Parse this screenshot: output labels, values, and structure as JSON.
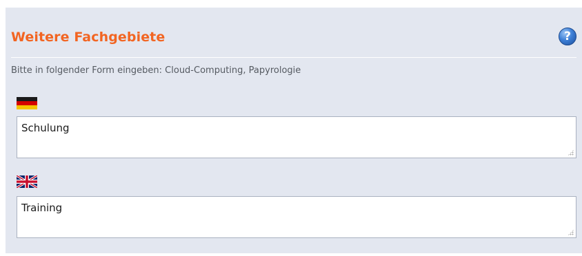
{
  "section": {
    "title": "Weitere Fachgebiete",
    "hint": "Bitte in folgender Form eingeben: Cloud-Computing, Papyrologie",
    "help_icon": "help-question-icon"
  },
  "fields": {
    "german": {
      "flag_icon": "flag-germany-icon",
      "value": "Schulung"
    },
    "english": {
      "flag_icon": "flag-uk-icon",
      "value": "Training"
    }
  },
  "colors": {
    "accent": "#f26522",
    "panel_background": "#e3e7f0",
    "hint_text": "#555a61"
  }
}
